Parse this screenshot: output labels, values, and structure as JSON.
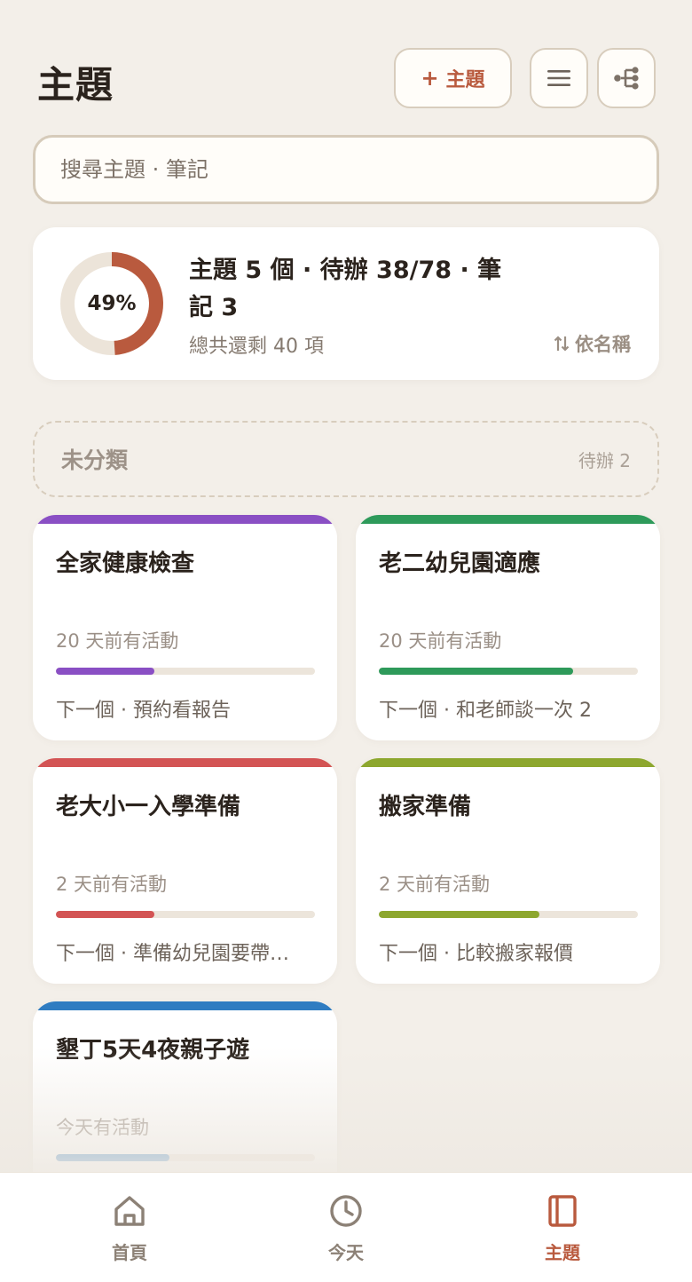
{
  "header": {
    "title": "主題",
    "add_label": "主題",
    "add_plus": "+"
  },
  "search": {
    "placeholder": "搜尋主題 · 筆記",
    "value": ""
  },
  "summary": {
    "percent_label": "49%",
    "percent": 49,
    "main": "主題 5 個 · 待辦 38/78 · 筆記 3",
    "sub": "總共還剩 40 項",
    "sort_label": "依名稱",
    "sort_icon": "sort-icon"
  },
  "uncategorized": {
    "title": "未分類",
    "count": "待辦 2"
  },
  "topics": [
    {
      "title": "全家健康檢查",
      "activity": "20 天前有活動",
      "next": "下一個 · 預約看報告",
      "color": "#8a4fc4",
      "progress": 0.38
    },
    {
      "title": "老二幼兒園適應",
      "activity": "20 天前有活動",
      "next": "下一個 · 和老師談一次 2",
      "color": "#2e9a5a",
      "progress": 0.75
    },
    {
      "title": "老大小一入學準備",
      "activity": "2 天前有活動",
      "next": "下一個 · 準備幼兒園要帶…",
      "color": "#d35454",
      "progress": 0.38
    },
    {
      "title": "搬家準備",
      "activity": "2 天前有活動",
      "next": "下一個 · 比較搬家報價",
      "color": "#8da72e",
      "progress": 0.62
    },
    {
      "title": "墾丁5天4夜親子遊",
      "activity": "今天有活動",
      "next": "",
      "color": "#2f7cc1",
      "progress": 0.44
    }
  ],
  "nav": {
    "items": [
      {
        "label": "首頁",
        "icon": "home-icon"
      },
      {
        "label": "今天",
        "icon": "clock-icon"
      },
      {
        "label": "主題",
        "icon": "notebook-icon"
      }
    ],
    "active_index": 2
  },
  "colors": {
    "accent": "#b95a3e",
    "background": "#f3efe9",
    "donut_track": "#ece4d9"
  }
}
